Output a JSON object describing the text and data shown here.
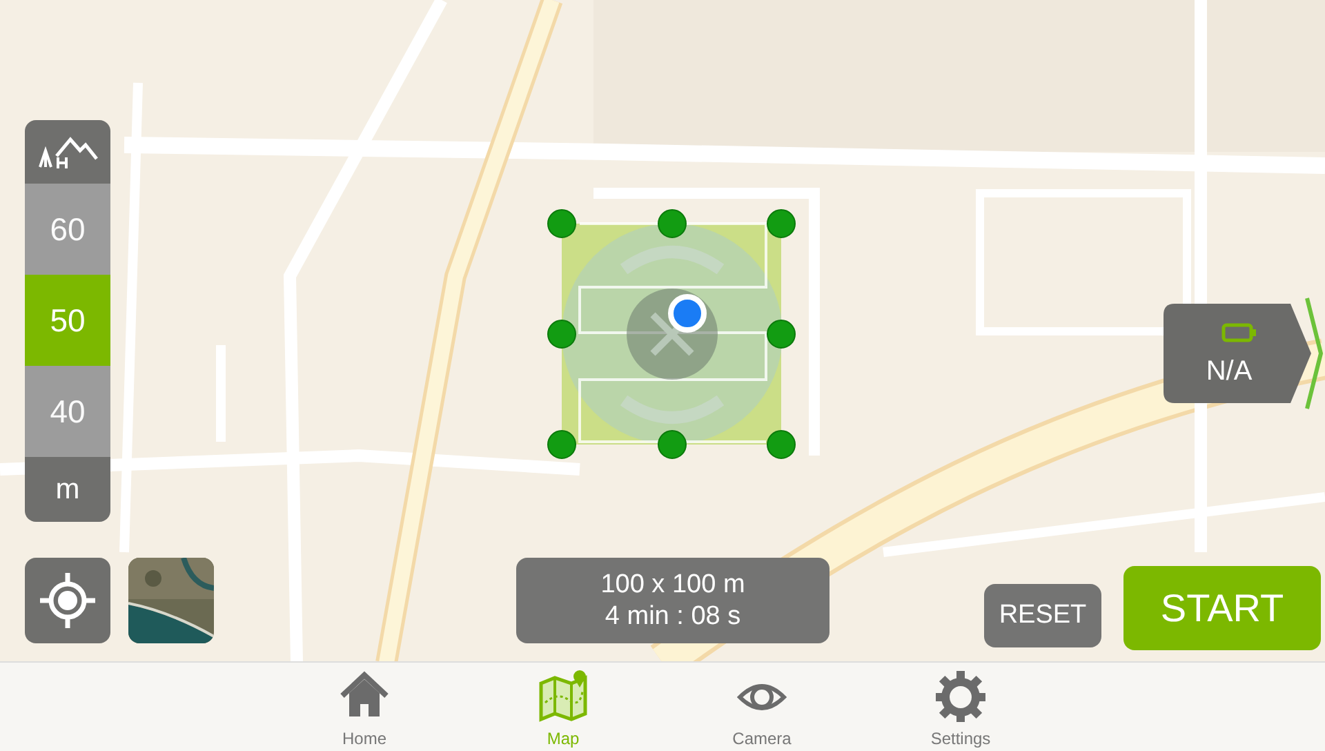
{
  "altitude": {
    "levels": [
      {
        "label": "60",
        "selected": false
      },
      {
        "label": "50",
        "selected": true
      },
      {
        "label": "40",
        "selected": false
      }
    ],
    "unit": "m"
  },
  "mission": {
    "area": "100 x 100 m",
    "duration": "4 min : 08 s"
  },
  "battery": {
    "reading": "N/A"
  },
  "buttons": {
    "reset": "RESET",
    "start": "START"
  },
  "tabs": [
    {
      "label": "Home",
      "kind": "home",
      "selected": false
    },
    {
      "label": "Map",
      "kind": "map",
      "selected": true
    },
    {
      "label": "Camera",
      "kind": "eye",
      "selected": false
    },
    {
      "label": "Settings",
      "kind": "gear",
      "selected": false
    }
  ]
}
